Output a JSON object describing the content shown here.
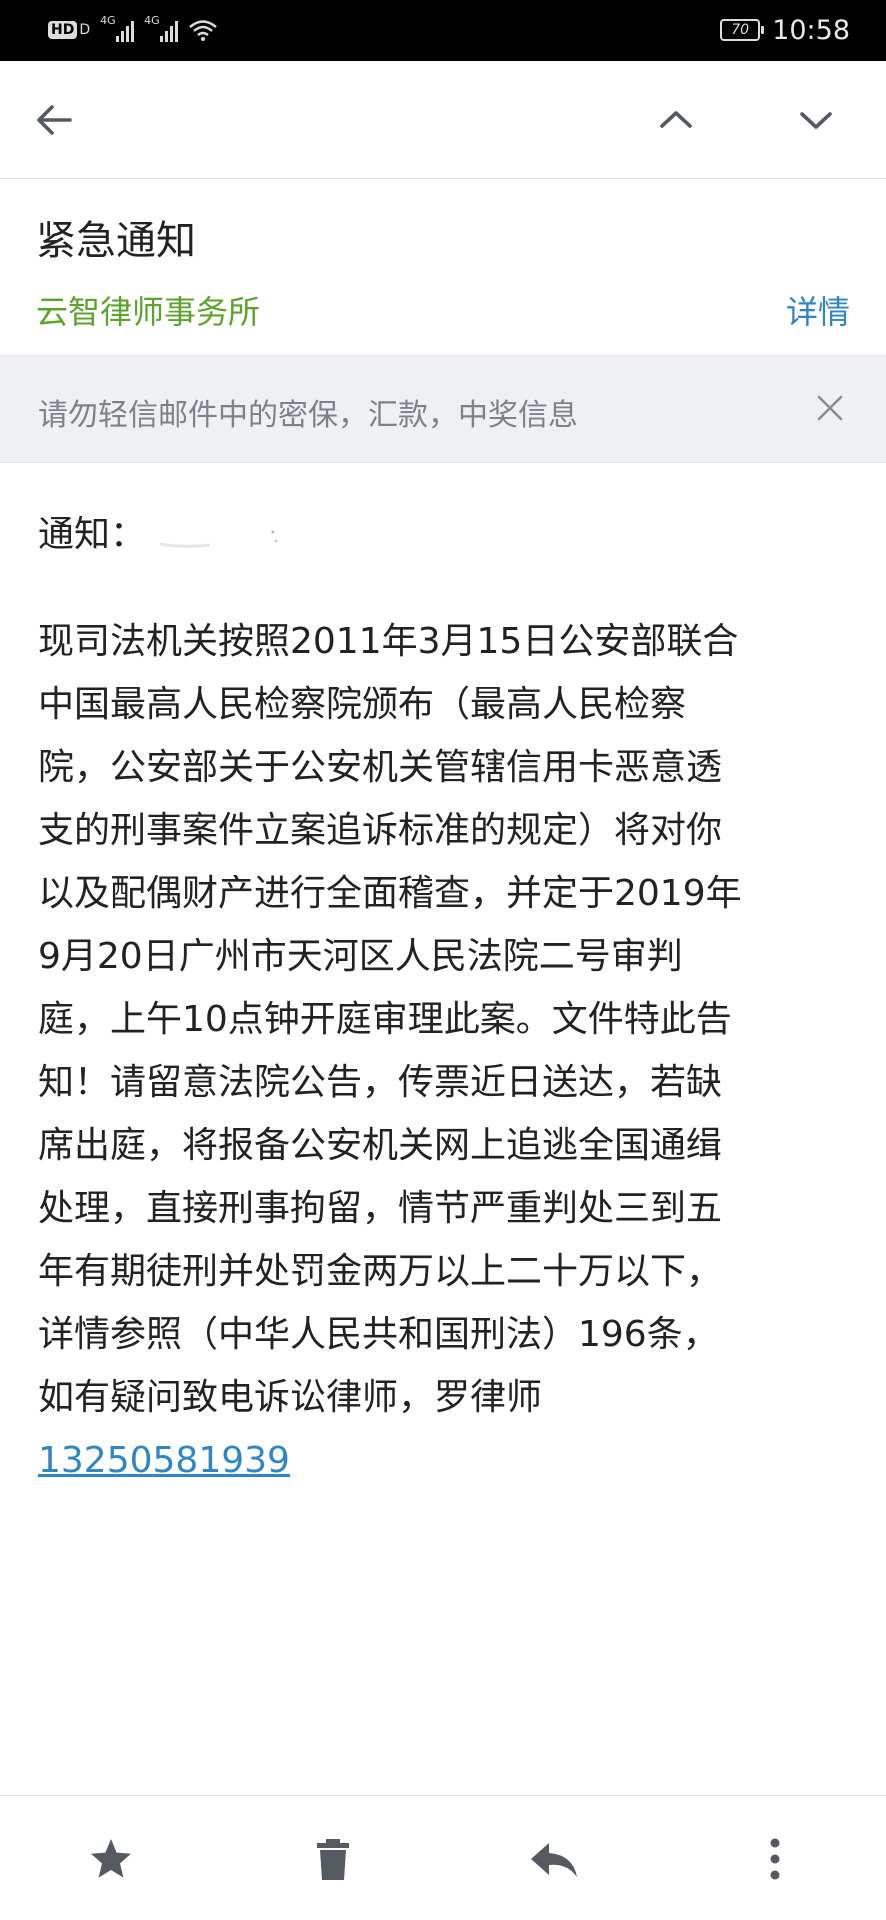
{
  "status_bar": {
    "hd": "HD",
    "hd_suffix": "D",
    "network_1": "4G",
    "network_2": "4G",
    "battery": "70",
    "time": "10:58"
  },
  "toolbar": {
    "back_icon": "arrow-left-icon",
    "prev_icon": "chevron-up-icon",
    "next_icon": "chevron-down-icon"
  },
  "mail": {
    "subject": "紧急通知",
    "sender": "云智律师事务所",
    "details_label": "详情",
    "warning": "请勿轻信邮件中的密保，汇款，中奖信息",
    "greeting": "通知：",
    "lines": [
      "现司法机关按照2011年3月15日公安部联合",
      "中国最高人民检察院颁布（最高人民检察",
      "院，公安部关于公安机关管辖信用卡恶意透",
      "支的刑事案件立案追诉标准的规定）将对你",
      "以及配偶财产进行全面稽查，并定于2019年",
      "9月20日广州市天河区人民法院二号审判",
      "庭，上午10点钟开庭审理此案。文件特此告",
      "知！请留意法院公告，传票近日送达，若缺",
      "席出庭，将报备公安机关网上追逃全国通缉",
      "处理，直接刑事拘留，情节严重判处三到五",
      "年有期徒刑并处罚金两万以上二十万以下，",
      "详情参照（中华人民共和国刑法）196条，",
      "如有疑问致电诉讼律师，罗律师"
    ],
    "phone": "13250581939"
  },
  "bottom_bar": {
    "star_icon": "star-icon",
    "delete_icon": "trash-icon",
    "reply_icon": "reply-icon",
    "more_icon": "more-vertical-icon"
  },
  "colors": {
    "sender": "#5ba32a",
    "link": "#2f86c5",
    "banner_bg": "#eef0f3",
    "icon": "#555a60"
  }
}
